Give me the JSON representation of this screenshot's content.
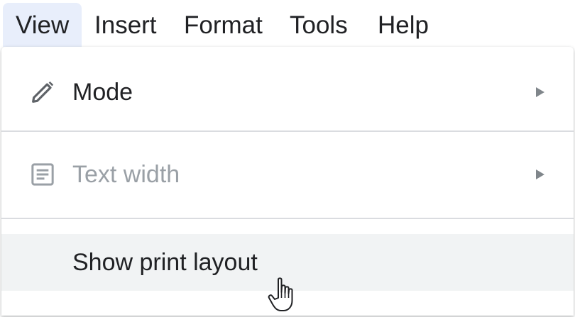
{
  "menubar": {
    "items": [
      {
        "label": "View",
        "active": true
      },
      {
        "label": "Insert",
        "active": false
      },
      {
        "label": "Format",
        "active": false
      },
      {
        "label": "Tools",
        "active": false
      },
      {
        "label": "Help",
        "active": false
      }
    ]
  },
  "view_menu": {
    "items": [
      {
        "label": "Mode",
        "icon": "pencil-icon",
        "has_submenu": true,
        "disabled": false
      },
      {
        "label": "Text width",
        "icon": "document-lines-icon",
        "has_submenu": true,
        "disabled": true
      },
      {
        "label": "Show print layout",
        "icon": null,
        "has_submenu": false,
        "disabled": false,
        "hovered": true
      }
    ]
  },
  "colors": {
    "active_menu_bg": "#e8eefb",
    "hover_row_bg": "#f1f3f4",
    "text": "#202124",
    "disabled_text": "#9aa0a6",
    "divider": "#dadce0"
  },
  "cursor": {
    "type": "pointer-hand-icon"
  }
}
